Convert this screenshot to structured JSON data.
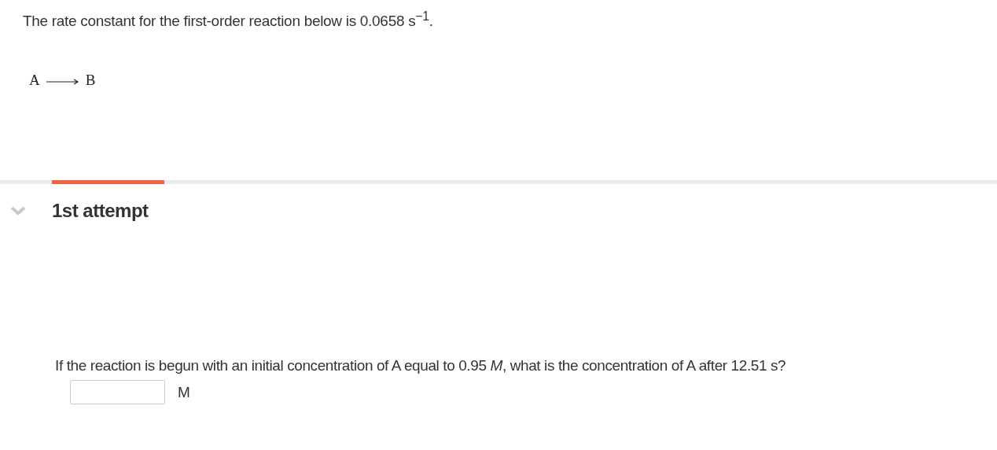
{
  "intro": "The rate constant for the first-order reaction below is 0.0658  s$^{−1}$.",
  "reaction": {
    "reactant": "A",
    "product": "B"
  },
  "attempt": {
    "title": "1st attempt",
    "expanded": true
  },
  "question": "If the reaction is begun with an initial concentration of A equal to 0.95 *M*, what is the concentration of A after 12.51 s?",
  "answer": {
    "unit": "M"
  }
}
